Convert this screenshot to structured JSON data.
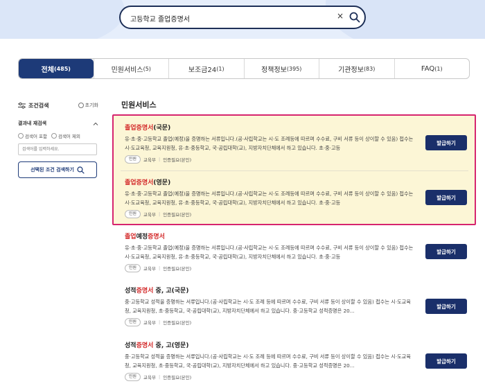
{
  "search": {
    "value": "고등학교 졸업증명서",
    "clear_icon": "×"
  },
  "tabs": [
    {
      "label": "전체",
      "count": "(485)"
    },
    {
      "label": "민원서비스",
      "count": "(5)"
    },
    {
      "label": "보조금24",
      "count": "(1)"
    },
    {
      "label": "정책정보",
      "count": "(395)"
    },
    {
      "label": "기관정보",
      "count": "(83)"
    },
    {
      "label": "FAQ",
      "count": "(1)"
    }
  ],
  "filter": {
    "title": "조건검색",
    "reset": "초기화",
    "within_title": "결과내 재검색",
    "include": "검색어 포함",
    "exclude": "검색어 제외",
    "input_placeholder": "검색어를 입력하세요.",
    "apply_button": "선택된 조건 검색하기"
  },
  "section_title": "민원서비스",
  "results": [
    {
      "title_kw": "졸업증명서",
      "title_rest": "(국문)",
      "desc": "유·초·중·고등학교 졸업(예정)을 증명하는 서류입니다.(공·사립학교는 시·도 조례등에 따르며 수수료, 구비 서류 등이 상이할 수 있음) 접수는 시·도교육청, 교육지원청, 유·초·중등학교, 국·공립대학(교), 지방자치단체에서 하고 있습니다. 초·중·고등",
      "badge": "민원",
      "org": "교육부",
      "auth": "인증필요(본인)",
      "button": "발급하기"
    },
    {
      "title_kw": "졸업증명서",
      "title_rest": "(영문)",
      "desc": "유·초·중·고등학교 졸업(예정)을 증명하는 서류입니다.(공·사립학교는 시·도 조례등에 따르며 수수료, 구비 서류 등이 상이할 수 있음) 접수는 시·도교육청, 교육지원청, 유·초·중등학교, 국·공립대학(교), 지방자치단체에서 하고 있습니다. 초·중·고등",
      "badge": "민원",
      "org": "교육부",
      "auth": "인증필요(본인)",
      "button": "발급하기"
    },
    {
      "title_kw_a": "졸업",
      "title_mid": "예정",
      "title_kw_b": "증명서",
      "desc": "유·초·중·고등학교 졸업(예정)을 증명하는 서류입니다.(공·사립학교는 시·도 조례등에 따르며 수수료, 구비 서류 등이 상이할 수 있음) 접수는 시·도교육청, 교육지원청, 유·초·중등학교, 국·공립대학(교), 지방자치단체에서 하고 있습니다. 초·중·고등",
      "badge": "민원",
      "org": "교육부",
      "auth": "인증필요(본인)",
      "button": "발급하기"
    },
    {
      "title_pre": "성적",
      "title_kw": "증명서",
      "title_rest": " 중, 고(국문)",
      "desc": "중·고등학교 성적을 증명하는 서류입니다.(공·사립학교는 시·도 조례 등에 따르며 수수료, 구비 서류 등이 상이할 수 있음) 접수는 시·도교육청, 교육지원청, 초·중등학교, 국·공립대학(교), 지방자치단체에서 하고 있습니다. 중·고등학교 성적증명은 20...",
      "badge": "민원",
      "org": "교육부",
      "auth": "인증필요(본인)",
      "button": "발급하기"
    },
    {
      "title_pre": "성적",
      "title_kw": "증명서",
      "title_rest": " 중, 고(영문)",
      "desc": "중·고등학교 성적을 증명하는 서류입니다.(공·사립학교는 시·도 조례 등에 따르며 수수료, 구비 서류 등이 상이할 수 있음) 접수는 시·도교육청, 교육지원청, 초·중등학교, 국·공립대학(교), 지방자치단체에서 하고 있습니다. 중·고등학교 성적증명은 20...",
      "badge": "민원",
      "org": "교육부",
      "auth": "인증필요(본인)",
      "button": "발급하기"
    }
  ],
  "colors": {
    "accent": "#1d3a78",
    "keyword": "#d32a2a",
    "highlight_border": "#d6246e",
    "highlight_bg": "#fcf6d6"
  }
}
